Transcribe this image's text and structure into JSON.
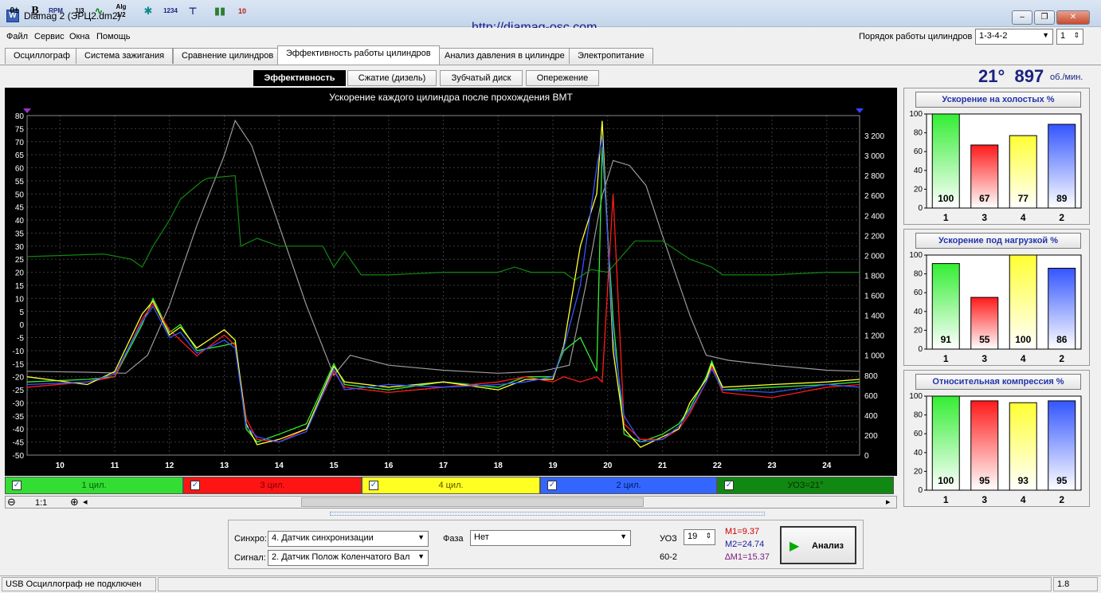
{
  "window": {
    "title": "Diamag 2 (ЭРЦ2.dm2)",
    "url": "http://diamag-osc.com",
    "btn_min": "‒",
    "btn_max": "❐",
    "btn_close": "✕",
    "app_icon": "oscilloscope-icon"
  },
  "menu": [
    "Файл",
    "Сервис",
    "Окна",
    "Помощь"
  ],
  "firing_order": {
    "label": "Порядок работы цилиндров",
    "value": "1-3-4-2",
    "spin": "1"
  },
  "tabs": [
    "Осциллограф",
    "Система зажигания",
    "Сравнение цилиндров",
    "Эффективность работы цилиндров",
    "Анализ давления в цилиндре",
    "Электропитание"
  ],
  "subtabs": [
    "Эффективность",
    "Сжатие (дизель)",
    "Зубчатый диск",
    "Опережение"
  ],
  "rpm": {
    "angle": "21°",
    "value": "897",
    "unit": "об./мин."
  },
  "toolbar_icons": [
    "0-adjust-icon",
    "bold-b-icon",
    "rpm-icon",
    "1-3-icon",
    "wave-icon",
    "alg-1-2-icon",
    "bug-icon",
    "1234-icon",
    "filter-icon",
    "bars-icon",
    "10-icon"
  ],
  "colors": {
    "cyl1": "#33ee33",
    "cyl3": "#ff1a1a",
    "cyl4": "#ffff33",
    "cyl2": "#3355ff",
    "uoz": "#118811",
    "rpm_trace": "#9a9a9a",
    "accent": "#2233aa"
  },
  "chart_data": [
    {
      "type": "line",
      "title": "Ускорение каждого цилиндра после прохождения ВМТ",
      "x_ticks": [
        "10",
        "11",
        "12",
        "13",
        "14",
        "15",
        "16",
        "17",
        "18",
        "19",
        "20",
        "21",
        "22",
        "23",
        "24"
      ],
      "y_left_ticks": [
        "80",
        "75",
        "70",
        "65",
        "60",
        "55",
        "50",
        "45",
        "40",
        "35",
        "30",
        "25",
        "20",
        "15",
        "10",
        "5",
        "0",
        "-5",
        "-10",
        "-15",
        "-20",
        "-25",
        "-30",
        "-35",
        "-40",
        "-45",
        "-50"
      ],
      "y_right_ticks": [
        "3 200",
        "3 000",
        "2 800",
        "2 600",
        "2 400",
        "2 200",
        "2 000",
        "1 800",
        "1 600",
        "1 400",
        "1 200",
        "1 000",
        "800",
        "600",
        "400",
        "200",
        "0"
      ],
      "xlim": [
        9.4,
        24.6
      ],
      "ylim": [
        -50,
        80
      ],
      "y2lim": [
        0,
        3400
      ],
      "grid": true,
      "rpm_series": {
        "x": [
          9.4,
          10.5,
          11.2,
          11.6,
          12,
          12.5,
          13,
          13.2,
          13.5,
          14,
          14.5,
          15,
          15.3,
          16,
          17,
          18,
          18.8,
          19.3,
          19.6,
          19.9,
          20.1,
          20.4,
          20.7,
          21,
          21.5,
          21.8,
          22.2,
          23,
          24,
          24.6
        ],
        "y": [
          840,
          830,
          820,
          1000,
          1500,
          2300,
          3000,
          3350,
          3100,
          2300,
          1500,
          800,
          1000,
          900,
          850,
          820,
          840,
          900,
          1700,
          2600,
          2950,
          2900,
          2700,
          2200,
          1400,
          1000,
          950,
          900,
          850,
          840
        ]
      },
      "uoz_series": {
        "x": [
          9.4,
          10.8,
          11.3,
          11.5,
          11.7,
          12,
          12.2,
          12.6,
          12.7,
          13.2,
          13.3,
          13.6,
          14,
          14.8,
          15,
          15.2,
          15.5,
          16,
          17,
          18,
          18.3,
          18.6,
          19.2,
          19.4,
          19.7,
          20,
          20.5,
          21,
          21.5,
          21.9,
          22.1,
          23,
          24,
          24.6
        ],
        "y": [
          26,
          27,
          25,
          22,
          30,
          40,
          48,
          55,
          56,
          57,
          30,
          33,
          30,
          30,
          22,
          28,
          19,
          19,
          20,
          20,
          22,
          20,
          20,
          17,
          21,
          20,
          32,
          32,
          25,
          22,
          19,
          19,
          20,
          20
        ]
      },
      "cylinders": [
        {
          "x": [
            9.4,
            10.5,
            11,
            11.5,
            11.7,
            12,
            12.2,
            12.5,
            13,
            13.2,
            13.4,
            13.6,
            14,
            14.5,
            15,
            15.2,
            16,
            17,
            18,
            18.5,
            19,
            19.2,
            19.5,
            19.8,
            19.9,
            20.1,
            20.3,
            20.6,
            21,
            21.3,
            21.5,
            21.8,
            21.9,
            22.1,
            23,
            24,
            24.6
          ],
          "y": [
            -22,
            -21,
            -20,
            0,
            10,
            -3,
            0,
            -10,
            -8,
            -7,
            -40,
            -45,
            -42,
            -38,
            -15,
            -23,
            -25,
            -22,
            -24,
            -20,
            -20,
            -10,
            -5,
            -18,
            68,
            2,
            -42,
            -45,
            -42,
            -38,
            -32,
            -20,
            -14,
            -25,
            -24,
            -23,
            -22
          ]
        },
        {
          "x": [
            9.4,
            10.5,
            11,
            11.5,
            11.7,
            12,
            12.2,
            12.5,
            13,
            13.2,
            13.4,
            13.6,
            14,
            14.5,
            15,
            15.2,
            16,
            17,
            18,
            18.5,
            19,
            19.2,
            19.5,
            19.8,
            19.9,
            20.1,
            20.3,
            20.6,
            21,
            21.3,
            21.5,
            21.8,
            21.9,
            22.1,
            23,
            24,
            24.6
          ],
          "y": [
            -24,
            -22,
            -20,
            2,
            8,
            -2,
            -6,
            -12,
            -4,
            -8,
            -36,
            -44,
            -45,
            -40,
            -18,
            -24,
            -26,
            -24,
            -22,
            -20,
            -22,
            -20,
            -22,
            -20,
            -22,
            50,
            -38,
            -44,
            -44,
            -40,
            -34,
            -22,
            -16,
            -26,
            -28,
            -24,
            -23
          ]
        },
        {
          "x": [
            9.4,
            10.5,
            11,
            11.5,
            11.7,
            12,
            12.2,
            12.5,
            13,
            13.2,
            13.4,
            13.6,
            14,
            14.5,
            15,
            15.2,
            16,
            17,
            18,
            18.5,
            19,
            19.2,
            19.5,
            19.8,
            19.9,
            20.1,
            20.3,
            20.6,
            21,
            21.3,
            21.5,
            21.8,
            21.9,
            22.1,
            23,
            24,
            24.6
          ],
          "y": [
            -20,
            -23,
            -18,
            4,
            9,
            -4,
            -1,
            -9,
            -2,
            -6,
            -38,
            -46,
            -44,
            -40,
            -16,
            -22,
            -24,
            -22,
            -25,
            -21,
            -21,
            -8,
            30,
            50,
            78,
            -10,
            -40,
            -47,
            -43,
            -40,
            -30,
            -21,
            -15,
            -24,
            -23,
            -22,
            -21
          ]
        },
        {
          "x": [
            9.4,
            10.5,
            11,
            11.5,
            11.7,
            12,
            12.2,
            12.5,
            13,
            13.2,
            13.4,
            13.6,
            14,
            14.5,
            15,
            15.2,
            16,
            17,
            18,
            18.5,
            19,
            19.2,
            19.5,
            19.8,
            19.9,
            20.1,
            20.3,
            20.6,
            21,
            21.3,
            21.5,
            21.8,
            21.9,
            22.1,
            23,
            24,
            24.6
          ],
          "y": [
            -23,
            -22,
            -19,
            1,
            7,
            -5,
            -3,
            -11,
            -6,
            -9,
            -39,
            -43,
            -45,
            -41,
            -17,
            -25,
            -23,
            -24,
            -23,
            -22,
            -20,
            -9,
            15,
            60,
            72,
            -5,
            -35,
            -45,
            -44,
            -39,
            -33,
            -22,
            -17,
            -25,
            -26,
            -23,
            -24
          ]
        }
      ]
    },
    {
      "type": "bar",
      "title": "Ускорение на холостых %",
      "categories": [
        "1",
        "3",
        "4",
        "2"
      ],
      "values": [
        100,
        67,
        77,
        89
      ],
      "ylim": [
        0,
        100
      ],
      "y_ticks": [
        "100",
        "80",
        "60",
        "40",
        "20",
        "0"
      ]
    },
    {
      "type": "bar",
      "title": "Ускорение под нагрузкой %",
      "categories": [
        "1",
        "3",
        "4",
        "2"
      ],
      "values": [
        91,
        55,
        100,
        86
      ],
      "ylim": [
        0,
        100
      ],
      "y_ticks": [
        "100",
        "80",
        "60",
        "40",
        "20",
        "0"
      ]
    },
    {
      "type": "bar",
      "title": "Относительная компрессия %",
      "categories": [
        "1",
        "3",
        "4",
        "2"
      ],
      "values": [
        100,
        95,
        93,
        95
      ],
      "ylim": [
        0,
        100
      ],
      "y_ticks": [
        "100",
        "80",
        "60",
        "40",
        "20",
        "0"
      ]
    }
  ],
  "channels": [
    {
      "label": "1 цил.",
      "bg": "#33dd33",
      "fg": "#0a5a0a"
    },
    {
      "label": "3 цил.",
      "bg": "#ff1414",
      "fg": "#7a0000"
    },
    {
      "label": "4 цил.",
      "bg": "#ffff22",
      "fg": "#555500"
    },
    {
      "label": "2 цил.",
      "bg": "#3366ff",
      "fg": "#001a66"
    },
    {
      "label": "УОЗ=21°",
      "bg": "#118811",
      "fg": "#033003"
    }
  ],
  "check": "✓",
  "zoom": {
    "minus": "⊖",
    "label": "1:1",
    "plus": "⊕",
    "left": "◂",
    "right": "▸"
  },
  "controls": {
    "sync_label": "Синхро:",
    "sync_value": "4.  Датчик синхронизации",
    "signal_label": "Сигнал:",
    "signal_value": "2.  Датчик Полож Коленчатого Вал",
    "phase_label": "Фаза",
    "phase_value": "Нет",
    "uoz_label": "УОЗ",
    "uoz_value": "19",
    "teeth": "60-2",
    "m1": "M1=9.37",
    "m2": "M2=24.74",
    "dm": "∆M1=15.37",
    "analyze": "Анализ"
  },
  "status": {
    "left": "USB Осциллограф не подключен",
    "right": "1.8"
  }
}
